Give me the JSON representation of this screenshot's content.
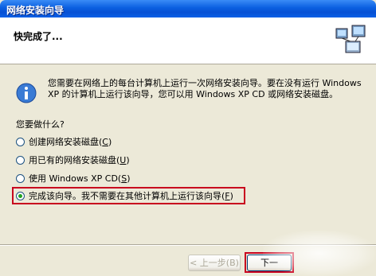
{
  "window": {
    "title": "网络安装向导"
  },
  "header": {
    "title": "快完成了..."
  },
  "info": {
    "text": "您需要在网络上的每台计算机上运行一次网络安装向导。要在没有运行 Windows XP 的计算机上运行该向导，您可以用 Windows XP CD 或网络安装磁盘。"
  },
  "question": "您要做什么?",
  "options": [
    {
      "label": "创建网络安装磁盘",
      "key": "C",
      "checked": false
    },
    {
      "label": "用已有的网络安装磁盘",
      "key": "U",
      "checked": false
    },
    {
      "label": "使用 Windows XP CD",
      "key": "S",
      "checked": false
    },
    {
      "label": "完成该向导。我不需要在其他计算机上运行该向导",
      "key": "F",
      "checked": true
    }
  ],
  "buttons": {
    "back": "< 上一步(B)",
    "next": "下一"
  },
  "colors": {
    "highlight": "#c8001e",
    "titlebar": "#0a5fe0"
  }
}
